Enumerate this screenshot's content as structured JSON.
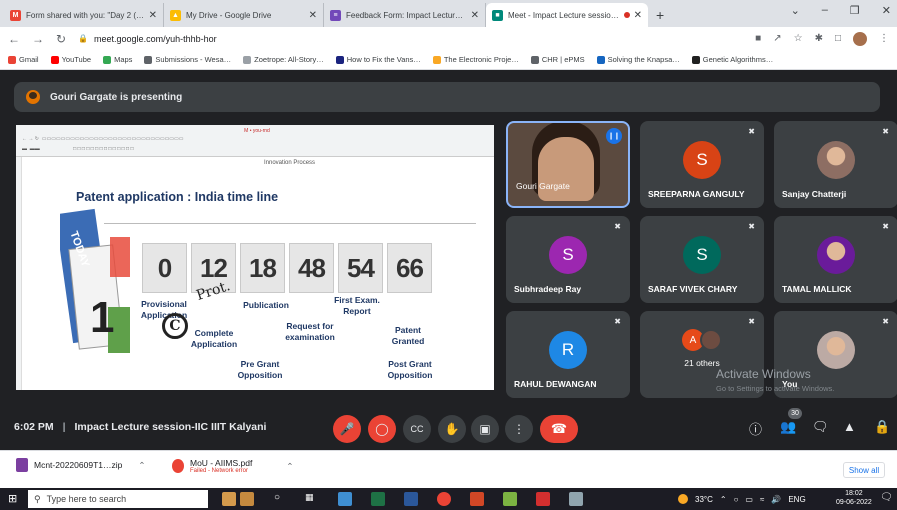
{
  "browser": {
    "tabs": [
      {
        "title": "Form shared with you: \"Day 2 (I…",
        "favicon": "gmail-icon",
        "color": "#ea4335",
        "glyph": "M"
      },
      {
        "title": "My Drive - Google Drive",
        "favicon": "drive-icon",
        "color": "#fbbc04",
        "glyph": "▲"
      },
      {
        "title": "Feedback Form: Impact Lecture S…",
        "favicon": "forms-icon",
        "color": "#7248b9",
        "glyph": "≡"
      },
      {
        "title": "Meet - Impact Lecture sessio…",
        "favicon": "meet-icon",
        "color": "#00897b",
        "glyph": "■"
      }
    ],
    "url": "meet.google.com/yuh-thhb-hor",
    "bookmarks": [
      {
        "label": "Gmail",
        "color": "#ea4335"
      },
      {
        "label": "YouTube",
        "color": "#ff0000"
      },
      {
        "label": "Maps",
        "color": "#34a853"
      },
      {
        "label": "Submissions - Wesa…",
        "color": "#5f6368"
      },
      {
        "label": "Zoetrope: All-Story…",
        "color": "#9aa0a6"
      },
      {
        "label": "How to Fix the Vans…",
        "color": "#1a237e"
      },
      {
        "label": "The Electronic Proje…",
        "color": "#f9a825"
      },
      {
        "label": "CHR | ePMS",
        "color": "#5f6368"
      },
      {
        "label": "Solving the Knapsa…",
        "color": "#1565c0"
      },
      {
        "label": "Genetic Algorithms…",
        "color": "#212121"
      }
    ]
  },
  "meet": {
    "presenting_label": "Gouri Gargate is presenting",
    "meeting_time": "6:02 PM",
    "meeting_title": "Impact Lecture session-IIC IIIT Kalyani",
    "participant_count": "30",
    "participants": [
      {
        "name": "Gouri Gargate",
        "initial": "",
        "color": "#6b5a4e",
        "speaking": true
      },
      {
        "name": "SREEPARNA GANGULY",
        "initial": "S",
        "color": "#d84315"
      },
      {
        "name": "Sanjay Chatterji",
        "initial": "",
        "color": "#8d6e63"
      },
      {
        "name": "Subhradeep Ray",
        "initial": "S",
        "color": "#9c27b0"
      },
      {
        "name": "SARAF VIVEK CHARY",
        "initial": "S",
        "color": "#00695c"
      },
      {
        "name": "TAMAL MALLICK",
        "initial": "",
        "color": "#6a1b9a"
      },
      {
        "name": "RAHUL DEWANGAN",
        "initial": "R",
        "color": "#1e88e5"
      },
      {
        "name": "21 others",
        "initial": "A",
        "color": "#e64a19"
      },
      {
        "name": "You",
        "initial": "",
        "color": "#bcaaa4"
      }
    ]
  },
  "slide": {
    "window_title": "M • you-rnd",
    "subtitle": "Innovation Process",
    "title": "Patent application : India time line",
    "numbers": [
      "0",
      "12",
      "18",
      "48",
      "54",
      "66"
    ],
    "labels": {
      "provisional": "Provisional Application",
      "complete": "Complete Application",
      "publication": "Publication",
      "request": "Request for examination",
      "first_exam": "First Exam. Report",
      "granted": "Patent Granted",
      "pre_grant": "Pre Grant Opposition",
      "post_grant": "Post Grant Opposition"
    },
    "calendar_text": "TODAY",
    "calendar_day": "1",
    "annotation_prot": "Prot.",
    "annotation_c": "C"
  },
  "watermark": {
    "title": "Activate Windows",
    "subtitle": "Go to Settings to activate Windows."
  },
  "downloads": [
    {
      "name": "Mcnt-20220609T1…zip",
      "status": ""
    },
    {
      "name": "MoU - AIIMS.pdf",
      "status": "Failed - Network error"
    }
  ],
  "downloads_show_all": "Show all",
  "taskbar": {
    "search_placeholder": "Type here to search",
    "temperature": "33°C",
    "lang": "ENG",
    "time": "18:02",
    "date": "09-06-2022"
  }
}
